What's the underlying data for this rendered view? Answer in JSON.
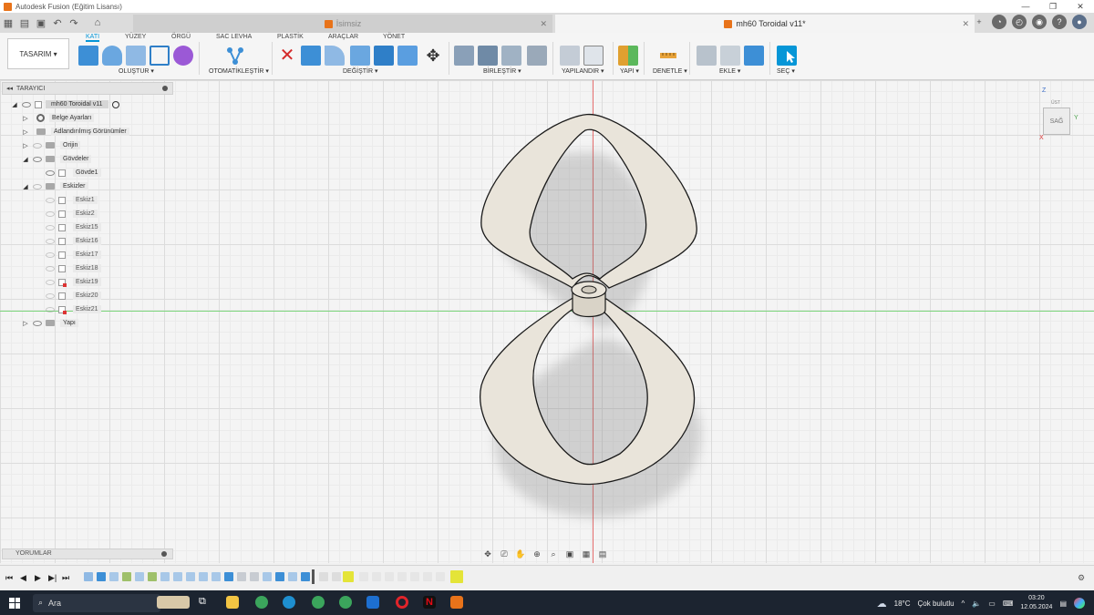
{
  "window": {
    "title": "Autodesk Fusion (Eğitim Lisansı)",
    "controls": [
      "—",
      "❐",
      "✕"
    ]
  },
  "tabs": {
    "inactive": "İsimsiz",
    "active": "mh60 Toroidal v11*"
  },
  "ribbon": {
    "workspace": "TASARIM ▾",
    "tabs": [
      "KATI",
      "YÜZEY",
      "ÖRGÜ",
      "SAC LEVHA",
      "PLASTİK",
      "ARAÇLAR",
      "YÖNET"
    ],
    "groups": [
      "OLUŞTUR ▾",
      "OTOMATİKLEŞTİR ▾",
      "DEĞİŞTİR ▾",
      "BİRLEŞTİR ▾",
      "YAPILANDIR ▾",
      "YAPI ▾",
      "DENETLE ▾",
      "EKLE ▾",
      "SEÇ ▾"
    ]
  },
  "browser": {
    "title": "TARAYICI",
    "root": "mh60 Toroidal v11",
    "items": {
      "settings": "Belge Ayarları",
      "views": "Adlandırılmış Görünümler",
      "origin": "Orijin",
      "bodies": "Gövdeler",
      "body1": "Gövde1",
      "sketches": "Eskizler",
      "construction": "Yapı"
    },
    "sketch_list": [
      "Eskiz1",
      "Eskiz2",
      "Eskiz15",
      "Eskiz16",
      "Eskiz17",
      "Eskiz18",
      "Eskiz19",
      "Eskiz20",
      "Eskiz21"
    ]
  },
  "viewcube": {
    "label": "SAĞ",
    "top": "ÜST",
    "axis_z": "Z",
    "axis_y": "Y",
    "axis_x": "X"
  },
  "comments": {
    "title": "YORUMLAR"
  },
  "taskbar": {
    "search": "Ara",
    "weather": "18°C",
    "weather_text": "Çok bulutlu",
    "time": "03:20",
    "date": "12.05.2024"
  },
  "colors": {
    "accent": "#0696d7",
    "part": "#e9e4da",
    "fusion_orange": "#e8731a"
  }
}
